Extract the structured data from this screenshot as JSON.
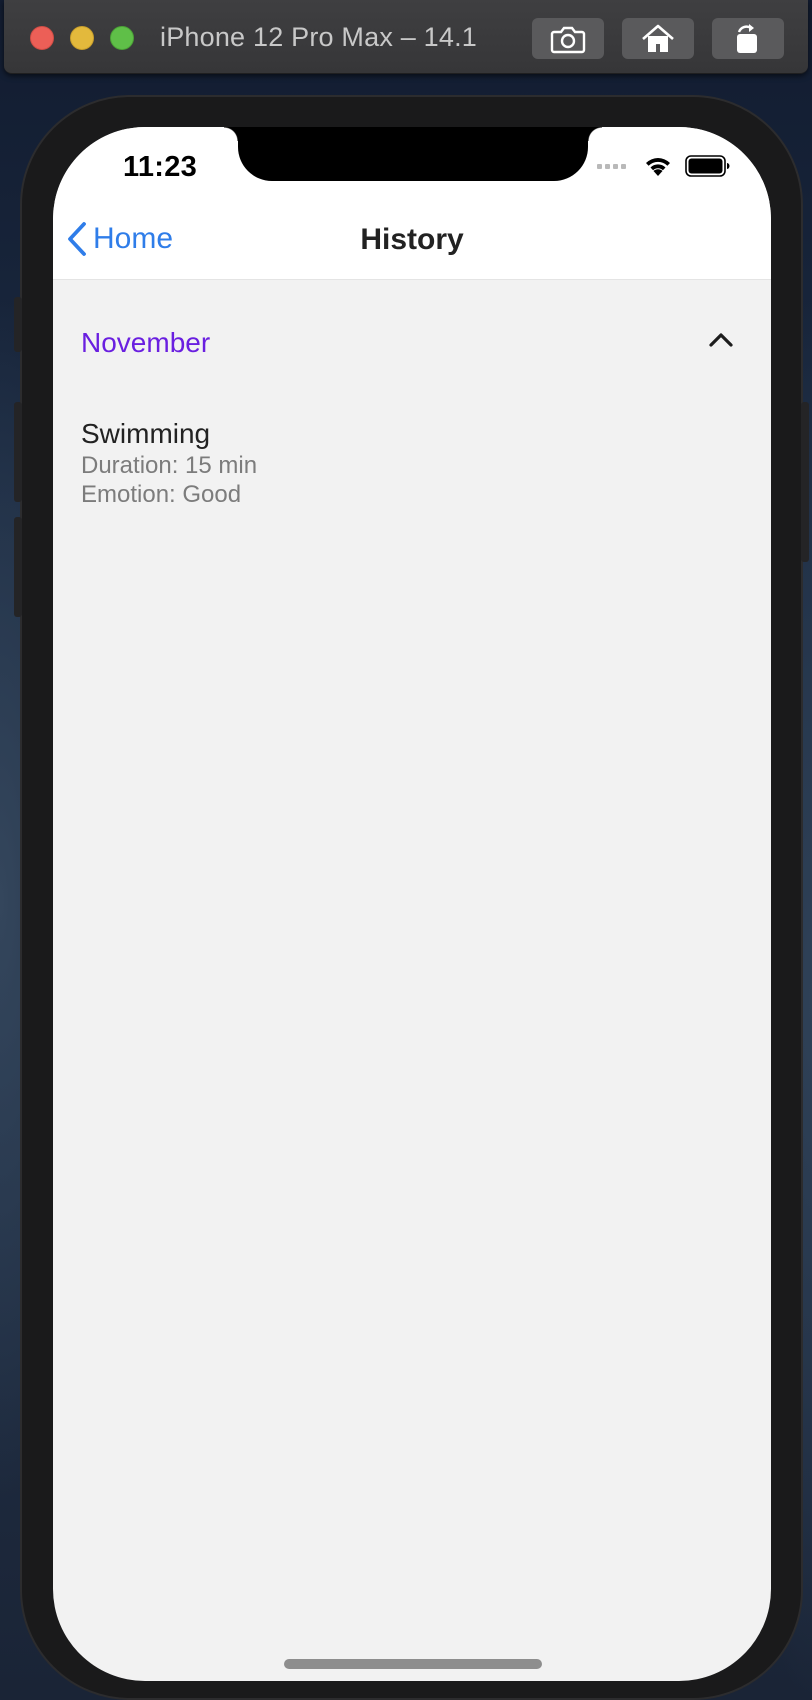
{
  "simulator": {
    "title": "iPhone 12 Pro Max – 14.1",
    "buttons": [
      {
        "icon": "camera-icon",
        "label": "Save Screen"
      },
      {
        "icon": "home-icon",
        "label": "Home"
      },
      {
        "icon": "rotate-icon",
        "label": "Rotate"
      }
    ]
  },
  "status_bar": {
    "time": "11:23",
    "icons": [
      "signal-icon",
      "wifi-icon",
      "battery-icon"
    ]
  },
  "nav": {
    "back_label": "Home",
    "title": "History"
  },
  "section": {
    "title": "November",
    "expanded": true,
    "entries": [
      {
        "activity": "Swimming",
        "duration": "Duration: 15 min",
        "emotion": "Emotion: Good"
      }
    ]
  },
  "colors": {
    "link_blue": "#2f7de9",
    "section_purple": "#6a1fe0",
    "background": "#f2f2f2"
  }
}
